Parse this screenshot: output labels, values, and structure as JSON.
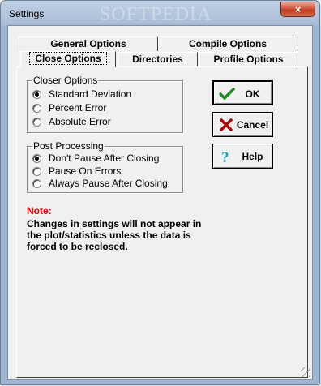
{
  "window": {
    "title": "Settings",
    "watermark": "SOFTPEDIA",
    "close_glyph": "×"
  },
  "tabs": {
    "row_back": [
      "General Options",
      "Compile Options"
    ],
    "row_front": [
      "Close Options",
      "Directories",
      "Profile Options"
    ],
    "active": "Close Options"
  },
  "closer_options": {
    "title": "Closer Options",
    "options": [
      "Standard Deviation",
      "Percent Error",
      "Absolute Error"
    ],
    "selected": "Standard Deviation"
  },
  "post_processing": {
    "title": "Post Processing",
    "options": [
      "Don't Pause After Closing",
      "Pause On Errors",
      "Always Pause After Closing"
    ],
    "selected": "Don't Pause After Closing"
  },
  "buttons": {
    "ok": "OK",
    "cancel": "Cancel",
    "help": "Help"
  },
  "note": {
    "title": "Note:",
    "lines": [
      "Changes in settings will not appear in",
      "the plot/statistics unless the data is",
      "forced  to be reclosed."
    ]
  },
  "icons": {
    "ok": "check-icon",
    "cancel": "x-icon",
    "help": "question-icon"
  },
  "colors": {
    "note_title": "#e00000",
    "ok_check": "#1f8a1f",
    "cancel_x": "#b00000",
    "help_question": "#1aa0b8",
    "close_button": "#c9472e"
  }
}
